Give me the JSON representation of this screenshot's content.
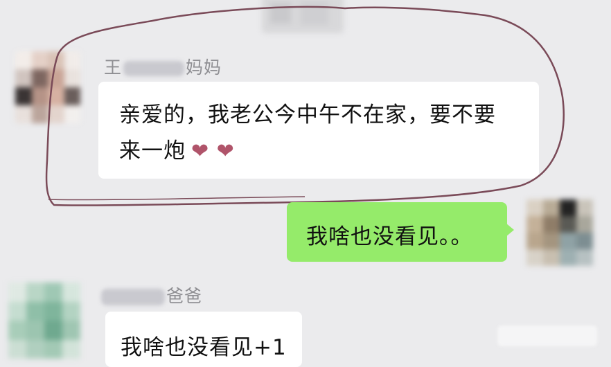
{
  "messages": {
    "first": {
      "sender": {
        "prefix": "王",
        "suffix": "妈妈"
      },
      "line1": "亲爱的，我老公今中午不在家，要不要",
      "line2": "来一炮",
      "hearts": "❤ ❤"
    },
    "reply": {
      "text": "我啥也没看见。。"
    },
    "second": {
      "sender": {
        "suffix": "爸爸"
      },
      "text": "我啥也没看见+1"
    }
  },
  "colors": {
    "background": "#ebebed",
    "outgoing_bubble": "#95eb6a",
    "incoming_bubble": "#ffffff",
    "scribble": "#7a4a58",
    "heart": "#b0546a"
  }
}
